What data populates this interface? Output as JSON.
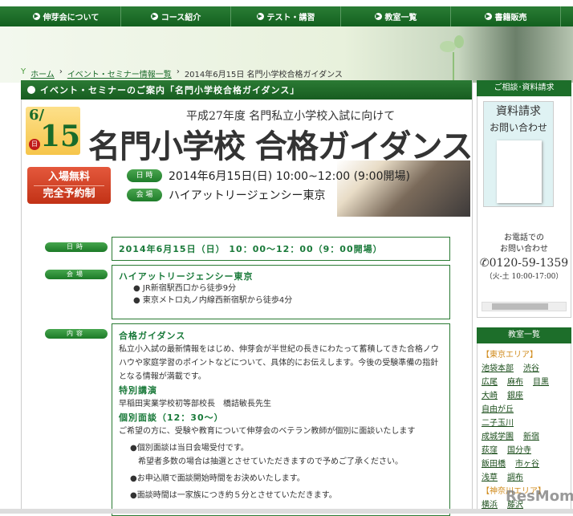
{
  "nav": [
    "伸芽会について",
    "コース紹介",
    "テスト・講習",
    "教室一覧",
    "書籍販売"
  ],
  "breadcrumb": {
    "home": "ホーム",
    "events": "イベント・セミナー情報一覧",
    "current": "2014年6月15日 名門小学校合格ガイダンス"
  },
  "main_title": "イベント・セミナーのご案内「名門小学校合格ガイダンス」",
  "banner": {
    "month": "6/",
    "day": "15",
    "weekday": "日",
    "subtitle": "平成27年度 名門私立小学校入試に向けて",
    "title": "名門小学校 合格ガイダンス",
    "free1": "入場無料",
    "free2": "完全予約制",
    "date_label": "日 時",
    "date": "2014年6月15日(日) 10:00~12:00 (9:00開場)",
    "venue_label": "会 場",
    "venue": "ハイアットリージェンシー東京"
  },
  "info": {
    "date_label": "日時",
    "date": "2014年6月15日（日） 10：00～12：00（9：00開場）",
    "venue_label": "会場",
    "venue": "ハイアットリージェンシー東京",
    "access": [
      "JR新宿駅西口から徒歩9分",
      "東京メトロ丸ノ内線西新宿駅から徒歩4分"
    ],
    "content_label": "内容",
    "h1": "合格ガイダンス",
    "p1": "私立小入試の最新情報をはじめ、伸芽会が半世紀の長きにわたって蓄積してきた合格ノウハウや家庭学習のポイントなどについて、具体的にお伝えします。今後の受験準備の指針となる情報が満載です。",
    "h2": "特別講演",
    "p2": "早稲田実業学校初等部校長　橋詰敏長先生",
    "h3": "個別面談（12：30～）",
    "p3": "ご希望の方に、受験や教育について伸芽会のベテラン教師が個別に面談いたします",
    "b1": "●個別面談は当日会場受付です。",
    "b1b": "希望者多数の場合は抽選とさせていただきますので予めご了承ください。",
    "b2": "●お申込順で面談開始時間をお決めいたします。",
    "b3": "●面談時間は一家族につき約５分とさせていただきます。"
  },
  "side": {
    "consult": "ご相談･資料請求",
    "req1": "資料請求",
    "req2": "お問い合わせ",
    "phone1": "お電話での",
    "phone2": "お問い合わせ",
    "phone": "0120-59-1359",
    "hours": "（火-土 10:00-17:00）",
    "classes": "教室一覧",
    "tokyo": "【東京エリア】",
    "rows": [
      [
        "池袋本部",
        "渋谷"
      ],
      [
        "広尾",
        "麻布",
        "目黒"
      ],
      [
        "大崎",
        "銀座"
      ],
      [
        "自由が丘"
      ],
      [
        "二子玉川"
      ],
      [
        "成城学園",
        "新宿"
      ],
      [
        "荻窪",
        "国分寺"
      ],
      [
        "飯田橋",
        "市ヶ谷"
      ],
      [
        "浅草",
        "調布"
      ]
    ],
    "kanagawa": "【神奈川エリア】",
    "krow": [
      "横浜",
      "藤沢"
    ]
  },
  "watermark": "ResMom"
}
